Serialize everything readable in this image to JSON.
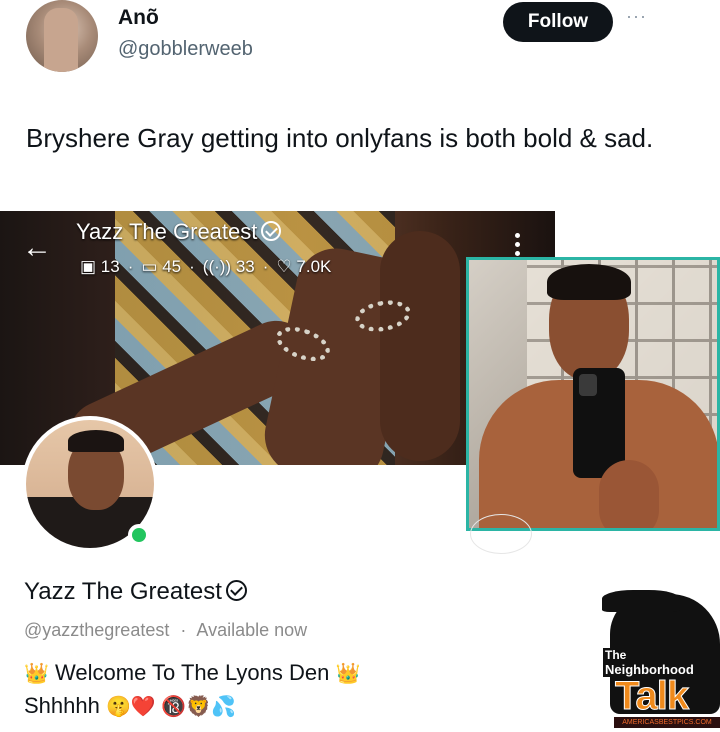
{
  "tweet": {
    "display_name": "Anõ",
    "handle": "@gobblerweeb",
    "follow_label": "Follow",
    "more_label": "···",
    "text": "Bryshere Gray getting into onlyfans is both bold & sad."
  },
  "embed": {
    "banner": {
      "back_glyph": "←",
      "name": "Yazz The Greatest",
      "stats": {
        "photos": "13",
        "videos": "45",
        "streams": "33",
        "likes": "7.0K"
      }
    },
    "profile": {
      "name": "Yazz The Greatest",
      "handle": "@yazzthegreatest",
      "separator": "·",
      "status": "Available now",
      "bio_line1": "Welcome To The Lyons Den",
      "bio_line2": "Shhhhh",
      "bio_emoji_crown": "👑",
      "bio_emoji_line2": "🤫❤️ 🔞🦁💦"
    }
  },
  "watermark": {
    "the": "The",
    "neighborhood": "Neighborhood",
    "talk": "Talk",
    "url": "AMERICASBESTPICS.COM"
  },
  "colors": {
    "follow_bg": "#0f1419",
    "inset_border": "#2bb5a5",
    "online": "#22c55e",
    "talk_orange": "#f08a1c"
  }
}
